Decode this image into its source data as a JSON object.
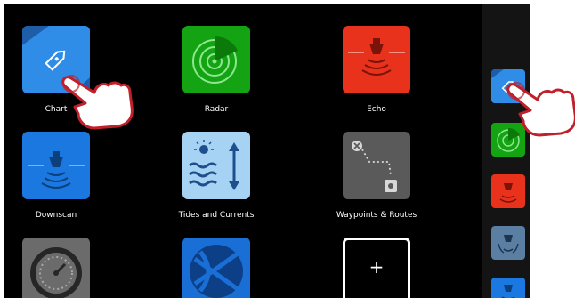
{
  "apps": [
    {
      "label": "Chart",
      "icon": "chart-icon",
      "color": "#2f8de8"
    },
    {
      "label": "Radar",
      "icon": "radar-icon",
      "color": "#13a313"
    },
    {
      "label": "Echo",
      "icon": "echo-icon",
      "color": "#e9321c"
    },
    {
      "label": "Downscan",
      "icon": "downscan-icon",
      "color": "#1a78e0"
    },
    {
      "label": "Tides and Currents",
      "icon": "tides-icon",
      "color": "#a6d2f4"
    },
    {
      "label": "Waypoints & Routes",
      "icon": "waypoints-icon",
      "color": "#5a5a5a"
    },
    {
      "label": "",
      "icon": "gauge-icon",
      "color": "#6b6b6b"
    },
    {
      "label": "",
      "icon": "globe-icon",
      "color": "#1a6fd6"
    },
    {
      "label": "+",
      "icon": "add-icon",
      "color": "#000000"
    }
  ],
  "sidebar": [
    {
      "icon": "chart-icon",
      "color": "#2f8de8"
    },
    {
      "icon": "radar-icon",
      "color": "#13a313"
    },
    {
      "icon": "echo-icon",
      "color": "#e9321c"
    },
    {
      "icon": "sonar-icon",
      "color": "#5b7fa3"
    },
    {
      "icon": "downscan-icon",
      "color": "#1a78e0"
    }
  ],
  "hands": [
    "pointing-hand-icon",
    "pointing-hand-icon"
  ]
}
